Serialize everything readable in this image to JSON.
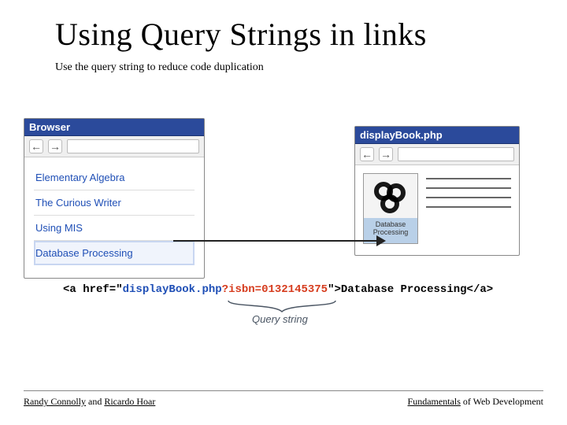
{
  "title": "Using Query Strings in links",
  "subtitle": "Use the query string to reduce code duplication",
  "browser_window": {
    "title": "Browser",
    "links": [
      "Elementary Algebra",
      "The Curious Writer",
      "Using MIS",
      "Database Processing"
    ]
  },
  "detail_window": {
    "title": "displayBook.php",
    "cover_title": "Database\nProcessing"
  },
  "code": {
    "pre": "<a href=\"",
    "file": "displayBook.php",
    "q_mark": "?",
    "query": "isbn=0132145375",
    "mid": "\">",
    "text": "Database Processing",
    "post": "</a>"
  },
  "query_string_label": "Query string",
  "footer": {
    "author1": "Randy Connolly",
    "between": " and ",
    "author2": "Ricardo Hoar",
    "right1": "Fundamentals",
    "right2": " of Web Development"
  }
}
